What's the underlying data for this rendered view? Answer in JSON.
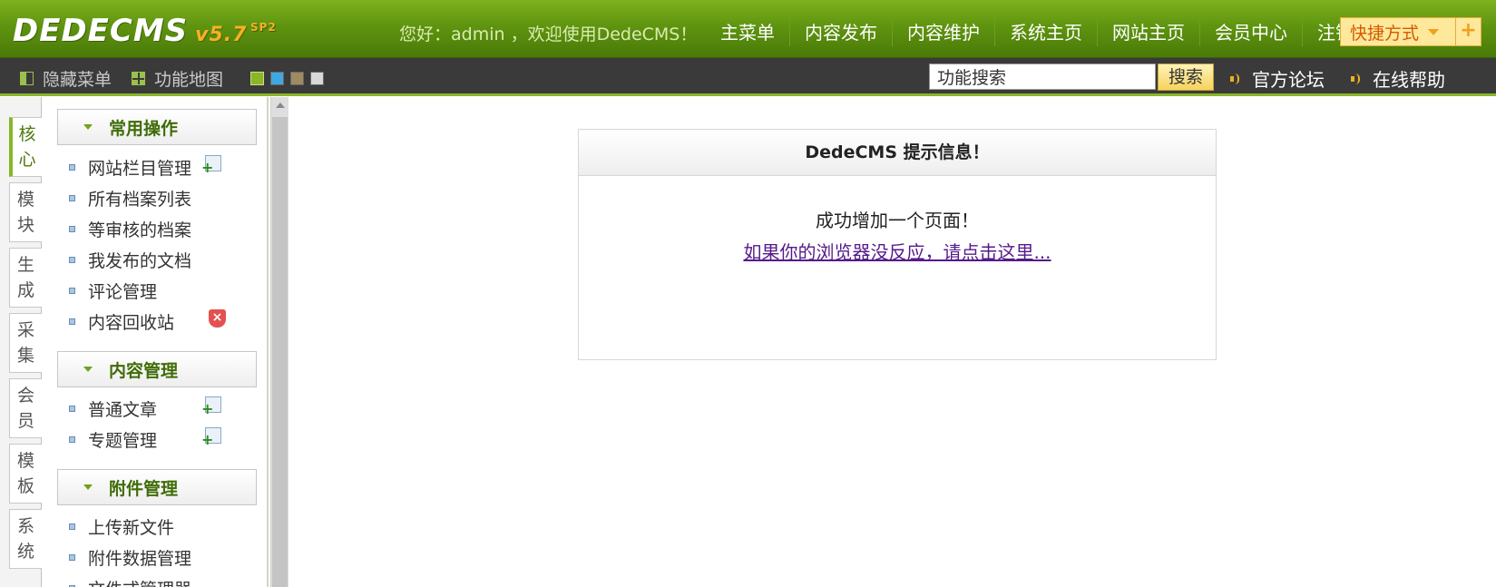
{
  "header": {
    "logo_text": "DEDECMS",
    "logo_version": "v5.7",
    "logo_sp": "SP2",
    "welcome": "您好：admin ，欢迎使用DedeCMS！",
    "nav": [
      "主菜单",
      "内容发布",
      "内容维护",
      "系统主页",
      "网站主页",
      "会员中心",
      "注销"
    ],
    "quick_label": "快捷方式",
    "quick_plus": "+"
  },
  "subbar": {
    "hide_menu": "隐藏菜单",
    "func_map": "功能地图",
    "skin_colors": [
      "#8ab628",
      "#3fa8e0",
      "#a08a60",
      "#d8d8d8"
    ],
    "search_value": "功能搜索",
    "search_button": "搜索",
    "forum": "官方论坛",
    "help": "在线帮助"
  },
  "vtabs": [
    {
      "l1": "核",
      "l2": "心"
    },
    {
      "l1": "模",
      "l2": "块"
    },
    {
      "l1": "生",
      "l2": "成"
    },
    {
      "l1": "采",
      "l2": "集"
    },
    {
      "l1": "会",
      "l2": "员"
    },
    {
      "l1": "模",
      "l2": "板"
    },
    {
      "l1": "系",
      "l2": "统"
    }
  ],
  "menu": {
    "group1_title": "常用操作",
    "group1_items": [
      "网站栏目管理",
      "所有档案列表",
      "等审核的档案",
      "我发布的文档",
      "评论管理",
      "内容回收站"
    ],
    "group2_title": "内容管理",
    "group2_items": [
      "普通文章",
      "专题管理"
    ],
    "group3_title": "附件管理",
    "group3_items": [
      "上传新文件",
      "附件数据管理",
      "文件式管理器"
    ]
  },
  "message": {
    "title": "DedeCMS 提示信息！",
    "text": "成功增加一个页面！",
    "link": "如果你的浏览器没反应，请点击这里..."
  },
  "icons": {
    "delete": "×"
  }
}
